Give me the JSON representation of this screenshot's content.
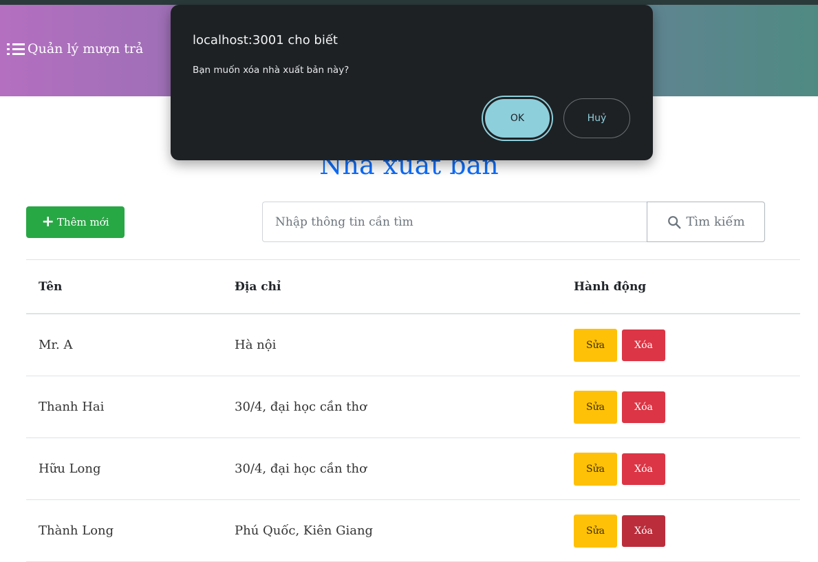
{
  "navbar": {
    "brand_icon": "list-icon",
    "brand_text": "Quản lý mượn trả"
  },
  "page": {
    "title": "Nhà xuất bản",
    "add_button": "Thêm mới",
    "search_placeholder": "Nhập thông tin cần tìm",
    "search_button": "Tìm kiếm"
  },
  "table": {
    "headers": [
      "Tên",
      "Địa chỉ",
      "Hành động"
    ],
    "rows": [
      {
        "name": "Mr. A",
        "address": "Hà nội",
        "edit": "Sửa",
        "delete": "Xóa"
      },
      {
        "name": "Thanh Hai",
        "address": "30/4, đại học cần thơ",
        "edit": "Sửa",
        "delete": "Xóa"
      },
      {
        "name": "Hữu Long",
        "address": "30/4, đại học cần thơ",
        "edit": "Sửa",
        "delete": "Xóa"
      },
      {
        "name": "Thành Long",
        "address": "Phú Quốc, Kiên Giang",
        "edit": "Sửa",
        "delete": "Xóa"
      }
    ]
  },
  "dialog": {
    "title": "localhost:3001 cho biết",
    "message": "Bạn muốn xóa nhà xuất bản này?",
    "ok": "OK",
    "cancel": "Huỷ"
  },
  "colors": {
    "add": "#28a745",
    "edit": "#ffc107",
    "delete": "#dc3545",
    "title": "#0d6efd",
    "dialog_bg": "#1e2124",
    "dialog_accent": "#8ecfdc"
  }
}
